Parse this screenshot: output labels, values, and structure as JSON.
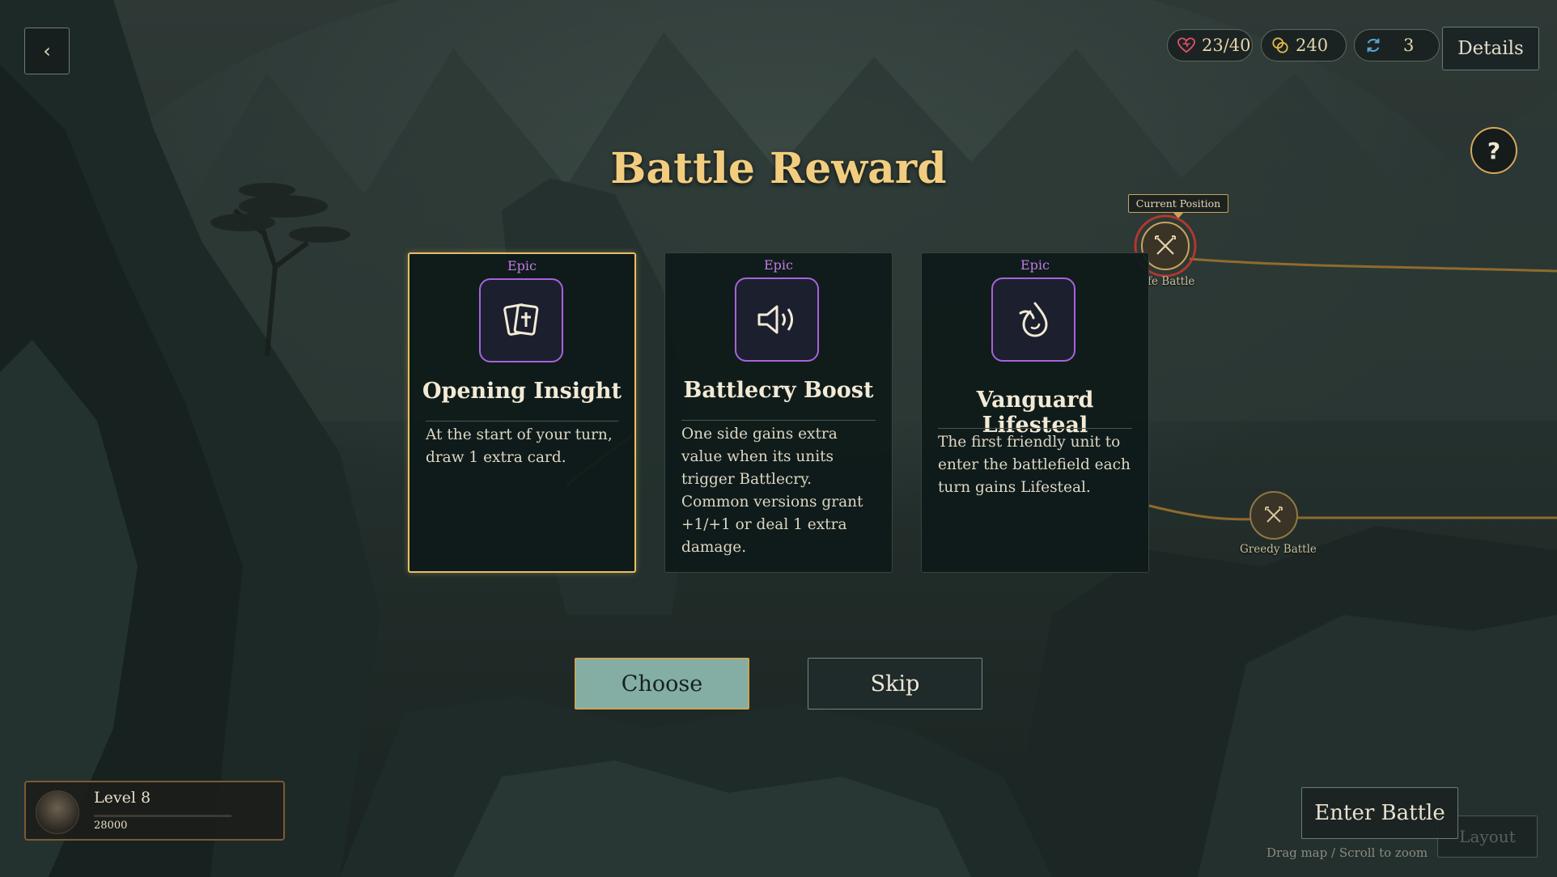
{
  "header": {
    "back_glyph": "‹",
    "health": "23/40",
    "gold": "240",
    "refresh": "3",
    "details_label": "Details",
    "help_glyph": "?"
  },
  "title": "Battle Reward",
  "cards": [
    {
      "rarity": "Epic",
      "name": "Opening Insight",
      "description": "At the start of your turn, draw 1 extra card.",
      "icon": "cards-icon",
      "selected": true
    },
    {
      "rarity": "Epic",
      "name": "Battlecry Boost",
      "description": "One side gains extra value when its units trigger Battlecry. Common versions grant +1/+1 or deal 1 extra damage.",
      "icon": "speaker-icon",
      "selected": false
    },
    {
      "rarity": "Epic",
      "name": "Vanguard Lifesteal",
      "description": "The first friendly unit to enter the battlefield each turn gains Lifesteal.",
      "icon": "drop-icon",
      "selected": false
    }
  ],
  "actions": {
    "choose_label": "Choose",
    "skip_label": "Skip"
  },
  "map": {
    "current_position_label": "Current Position",
    "current_node_label": "fe Battle",
    "greedy_node_label": "Greedy Battle",
    "enter_battle_label": "Enter Battle",
    "ghost_label": "Layout",
    "hint": "Drag map / Scroll to zoom"
  },
  "player": {
    "level_label": "Level 8",
    "xp": "28000",
    "xp_progress": 0.0
  },
  "colors": {
    "gold_accent": "#e7be63",
    "epic_purple": "#c27be8",
    "title_gold": "#f3cd7f",
    "choose_green": "#84aea4"
  }
}
